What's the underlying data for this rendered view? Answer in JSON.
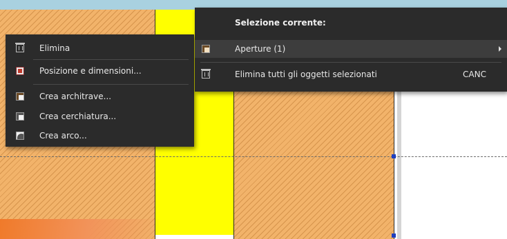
{
  "context_menu": {
    "items": [
      {
        "label": "Elimina",
        "icon": "trash-icon"
      },
      {
        "label": "Posizione e dimensioni...",
        "icon": "position-size-icon"
      },
      {
        "label": "Crea architrave...",
        "icon": "lintel-icon"
      },
      {
        "label": "Crea cerchiatura...",
        "icon": "frame-icon"
      },
      {
        "label": "Crea arco...",
        "icon": "arch-icon"
      }
    ]
  },
  "selection_menu": {
    "header": "Selezione corrente:",
    "items": [
      {
        "label": "Aperture (1)",
        "icon": "opening-icon",
        "has_submenu": true
      },
      {
        "label": "Elimina tutti gli oggetti selezionati",
        "shortcut": "CANC",
        "icon": "trash-icon"
      }
    ]
  },
  "colors": {
    "menu_bg": "#2b2b2b",
    "menu_text": "#e8e8e8",
    "hatch_fill": "#f2b36a",
    "selected_opening": "#ffff00"
  }
}
